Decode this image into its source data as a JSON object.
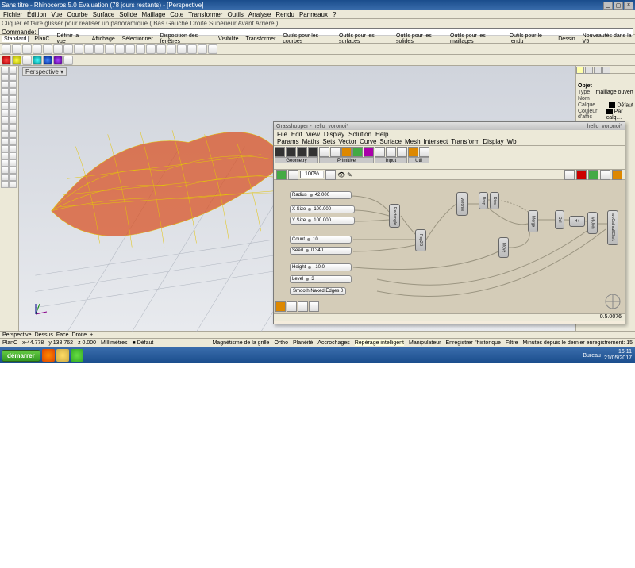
{
  "window": {
    "title": "Sans titre - Rhinoceros 5.0 Evaluation (78 jours restants) - [Perspective]"
  },
  "menu": {
    "items": [
      "Fichier",
      "Édition",
      "Vue",
      "Courbe",
      "Surface",
      "Solide",
      "Maillage",
      "Cote",
      "Transformer",
      "Outils",
      "Analyse",
      "Rendu",
      "Panneaux",
      "?"
    ]
  },
  "command": {
    "hint": "Cliquer et faire glisser pour réaliser un panoramique ( Bas  Gauche  Droite  Supérieur  Avant  Arrière ):",
    "label": "Commande:"
  },
  "tabs": {
    "items": [
      "Standard",
      "PlanC",
      "Définir la vue",
      "Affichage",
      "Sélectionner",
      "Disposition des fenêtres",
      "Visibilité",
      "Transformer",
      "Outils pour les courbes",
      "Outils pour les surfaces",
      "Outils pour les solides",
      "Outils pour les maillages",
      "Outils pour le rendu",
      "Dessin",
      "Nouveautés dans la V5"
    ]
  },
  "viewport": {
    "name": "Perspective ▾"
  },
  "properties": {
    "header": "Objet",
    "rows": [
      {
        "label": "Type",
        "value": "maillage ouvert"
      },
      {
        "label": "Nom",
        "value": ""
      },
      {
        "label": "Calque",
        "value": "Défaut"
      },
      {
        "label": "Couleur d'affic",
        "value": "Par calq…"
      }
    ]
  },
  "bottomTabs": [
    "Perspective",
    "Dessus",
    "Face",
    "Droite",
    "+"
  ],
  "status": {
    "plane": "PlanC",
    "x": "x-44.778",
    "y": "y 138.762",
    "z": "z 0.000",
    "units": "Millimètres",
    "layer": "Défaut",
    "osnaps": [
      "Magnétisme de la grille",
      "Ortho",
      "Planéité",
      "Accrochages",
      "Repérage intelligent",
      "Manipulateur",
      "Enregistrer l'historique",
      "Filtre",
      "Minutes depuis le dernier enregistrement: 15"
    ]
  },
  "taskbar": {
    "start": "démarrer",
    "tray": {
      "desk": "Bureau",
      "time": "16:11",
      "date": "21/05/2017"
    }
  },
  "gh": {
    "title": "Grasshopper - hello_voronoi*",
    "doc": "hello_voronoi*",
    "menu": [
      "File",
      "Edit",
      "View",
      "Display",
      "Solution",
      "Help"
    ],
    "tabs": [
      "Params",
      "Maths",
      "Sets",
      "Vector",
      "Curve",
      "Surface",
      "Mesh",
      "Intersect",
      "Transform",
      "Display",
      "Wb"
    ],
    "ribbonGroups": [
      "Geometry",
      "Primitive",
      "Input",
      "Util"
    ],
    "zoom": "100%",
    "status": "0.5.0076",
    "sliders": {
      "radius": {
        "label": "Radius",
        "value": "42.000"
      },
      "xsize": {
        "label": "X Size",
        "value": "100.000"
      },
      "ysize": {
        "label": "Y Size",
        "value": "100.000"
      },
      "count": {
        "label": "Count",
        "value": "10"
      },
      "seed": {
        "label": "Seed",
        "value": "0.340"
      },
      "height": {
        "label": "Height",
        "value": "-10.0"
      },
      "level": {
        "label": "Level",
        "value": "3"
      }
    },
    "toggle": {
      "label": "Smooth Naked Edges",
      "value": "0"
    },
    "components": {
      "rect": "Rectangle",
      "pop": "Pop2D",
      "vor": "Voronoi",
      "brep": "Brep",
      "divs": "Divs",
      "move1": "Move",
      "move2": "Move",
      "merge": "Merge",
      "del": "Del",
      "wbjoin": "wbJoin",
      "wbcc": "wbCatmullClark",
      "hplus": "H+"
    }
  }
}
